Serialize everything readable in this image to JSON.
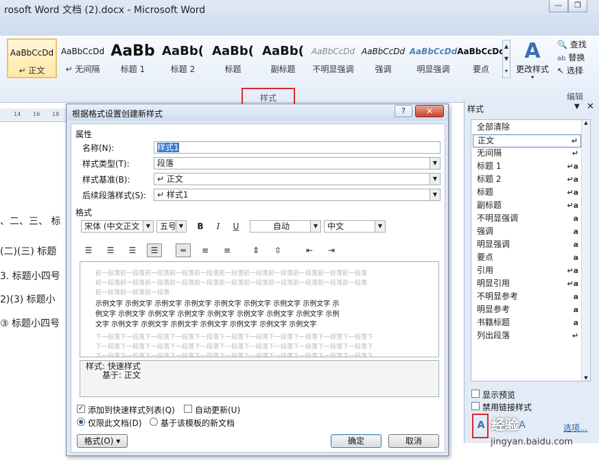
{
  "window": {
    "title": "rosoft Word 文档 (2).docx  -  Microsoft Word",
    "min_label": "—",
    "restore_label": "❐"
  },
  "ribbon": {
    "styles": [
      {
        "preview": "AaBbCcDd",
        "name": "↵ 正文",
        "selected": true
      },
      {
        "preview": "AaBbCcDd",
        "name": "↵ 无间隔"
      },
      {
        "preview": "AaBb",
        "name": "标题 1"
      },
      {
        "preview": "AaBb(",
        "name": "标题 2"
      },
      {
        "preview": "AaBb(",
        "name": "标题"
      },
      {
        "preview": "AaBb(",
        "name": "副标题"
      },
      {
        "preview": "AaBbCcDd",
        "name": "不明显强调"
      },
      {
        "preview": "AaBbCcDd",
        "name": "强调"
      },
      {
        "preview": "AaBbCcDd",
        "name": "明显强调"
      },
      {
        "preview": "AaBbCcDd",
        "name": "要点"
      }
    ],
    "change_styles_label": "更改样式",
    "find_label": "查找",
    "replace_label": "替换",
    "select_label": "选择",
    "styles_group_label": "样式",
    "editing_group_label": "编辑"
  },
  "ruler": {
    "ticks": [
      "14",
      "16",
      "18"
    ]
  },
  "document": {
    "lines": [
      "、二、三、 标",
      "(二)(三) 标题",
      "3. 标题小四号",
      "2)(3) 标题小",
      "③ 标题小四号"
    ]
  },
  "dialog": {
    "title": "根据格式设置创建新样式",
    "help_label": "?",
    "close_label": "✕",
    "properties_header": "属性",
    "name_label": "名称(N):",
    "name_value": "样式1",
    "type_label": "样式类型(T):",
    "type_value": "段落",
    "based_label": "样式基准(B):",
    "based_value": "↵ 正文",
    "next_label": "后续段落样式(S):",
    "next_value": "↵ 样式1",
    "format_header": "格式",
    "font_value": "宋体 (中文正文",
    "size_value": "五号",
    "bold_label": "B",
    "italic_label": "I",
    "underline_label": "U",
    "color_value": "自动",
    "lang_value": "中文",
    "preview_prev_lines": [
      "前一段落前一段落前一段落前一段落前一段落前一段落前一段落前一段落前一段落前一段落前一段落",
      "前一段落前一段落前一段落前一段落前一段落前一段落前一段落前一段落前一段落前一段落前一段落",
      "前一段落前一段落前一段落"
    ],
    "preview_sample_lines": [
      "示例文字 示例文字 示例文字 示例文字 示例文字 示例文字 示例文字 示例文字 示",
      "例文字 示例文字 示例文字 示例文字 示例文字 示例文字 示例文字 示例文字 示例",
      "文字 示例文字 示例文字 示例文字 示例文字 示例文字 示例文字 示例文字"
    ],
    "preview_next_lines": [
      "下一段落下一段落下一段落下一段落下一段落下一段落下一段落下一段落下一段落下一段落下一段落下",
      "下一段落下一段落下一段落下一段落下一段落下一段落下一段落下一段落下一段落下一段落下一段落下",
      "下一段落下一段落下一段落下一段落下一段落下一段落下一段落下一段落下一段落下一段落下一段落下"
    ],
    "desc_line1": "样式: 快速样式",
    "desc_line2": "基于: 正文",
    "add_quick_label": "添加到快速样式列表(Q)",
    "auto_update_label": "自动更新(U)",
    "only_doc_label": "仅限此文档(D)",
    "new_docs_label": "基于该模板的新文档",
    "format_btn_label": "格式(O) ▾",
    "ok_label": "确定",
    "cancel_label": "取消"
  },
  "styles_pane": {
    "title": "样式",
    "items": [
      {
        "name": "全部清除",
        "mark": ""
      },
      {
        "name": "正文",
        "mark": "↵",
        "selected": true
      },
      {
        "name": "无间隔",
        "mark": "↵"
      },
      {
        "name": "标题 1",
        "mark": "↵a"
      },
      {
        "name": "标题 2",
        "mark": "↵a"
      },
      {
        "name": "标题",
        "mark": "↵a"
      },
      {
        "name": "副标题",
        "mark": "↵a"
      },
      {
        "name": "不明显强调",
        "mark": "a"
      },
      {
        "name": "强调",
        "mark": "a"
      },
      {
        "name": "明显强调",
        "mark": "a"
      },
      {
        "name": "要点",
        "mark": "a"
      },
      {
        "name": "引用",
        "mark": "↵a"
      },
      {
        "name": "明显引用",
        "mark": "↵a"
      },
      {
        "name": "不明显参考",
        "mark": "a"
      },
      {
        "name": "明显参考",
        "mark": "a"
      },
      {
        "name": "书籍标题",
        "mark": "a"
      },
      {
        "name": "列出段落",
        "mark": "↵"
      }
    ],
    "show_preview_label": "显示预览",
    "disable_linked_label": "禁用链接样式",
    "options_label": "选项..."
  },
  "watermark": {
    "text": "经验",
    "url": "jingyan.baidu.com"
  }
}
